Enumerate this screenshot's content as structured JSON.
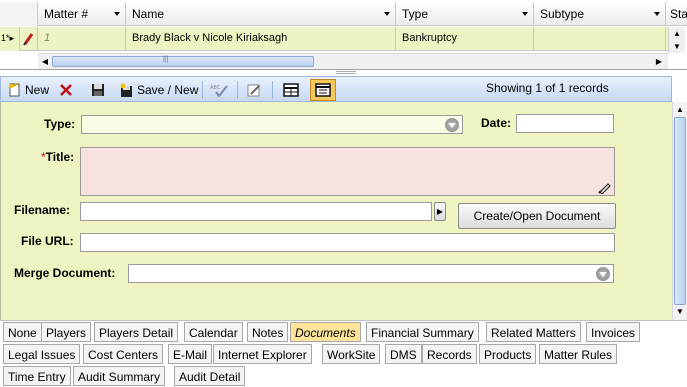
{
  "grid": {
    "columns": [
      "Matter #",
      "Name",
      "Type",
      "Subtype",
      "Sta"
    ],
    "row": {
      "selector": "1*▸",
      "matter_no": "1",
      "name": "Brady Black v Nicole Kiriaksagh",
      "type": "Bankruptcy",
      "subtype": "",
      "status": ""
    }
  },
  "toolbar": {
    "new_label": "New",
    "save_new_label": "Save / New",
    "showing": "Showing 1 of 1 records"
  },
  "form": {
    "type_label": "Type:",
    "type_value": "",
    "date_label": "Date:",
    "date_value": "",
    "title_required": "*",
    "title_label": "Title:",
    "title_value": "",
    "filename_label": "Filename:",
    "filename_value": "",
    "create_open_label": "Create/Open Document",
    "file_url_label": "File URL:",
    "file_url_value": "",
    "merge_label": "Merge Document:",
    "merge_value": ""
  },
  "tabs": {
    "active": "Documents",
    "rows": [
      [
        "None",
        "Players",
        "Players Detail",
        "Calendar",
        "Notes",
        "Documents",
        "Financial Summary",
        "Related Matters",
        "Invoices"
      ],
      [
        "Legal Issues",
        "Cost Centers",
        "E-Mail",
        "Internet Explorer",
        "WorkSite",
        "DMS",
        "Records",
        "Products",
        "Matter Rules"
      ],
      [
        "Time Entry",
        "Audit Summary",
        "Audit Detail"
      ]
    ]
  },
  "colors": {
    "row_highlight": "#eef3c4",
    "form_bg": "#f0f3c2",
    "title_bg": "#f7e1e1",
    "active_tab": "#fde49a",
    "required": "#cc0000"
  }
}
